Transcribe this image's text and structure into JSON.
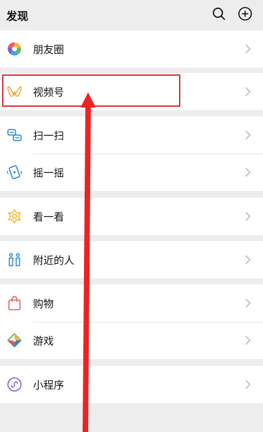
{
  "header": {
    "title": "发现",
    "search_icon": "search-icon",
    "add_icon": "plus-circle-icon"
  },
  "menu": {
    "moments": "朋友圈",
    "channels": "视频号",
    "scan": "扫一扫",
    "shake": "摇一摇",
    "top_stories": "看一看",
    "nearby": "附近的人",
    "shopping": "购物",
    "games": "游戏",
    "mini_programs": "小程序"
  },
  "colors": {
    "background": "#ededed",
    "row": "#ffffff",
    "highlight": "#d9343a",
    "arrow": "#ee2222"
  }
}
